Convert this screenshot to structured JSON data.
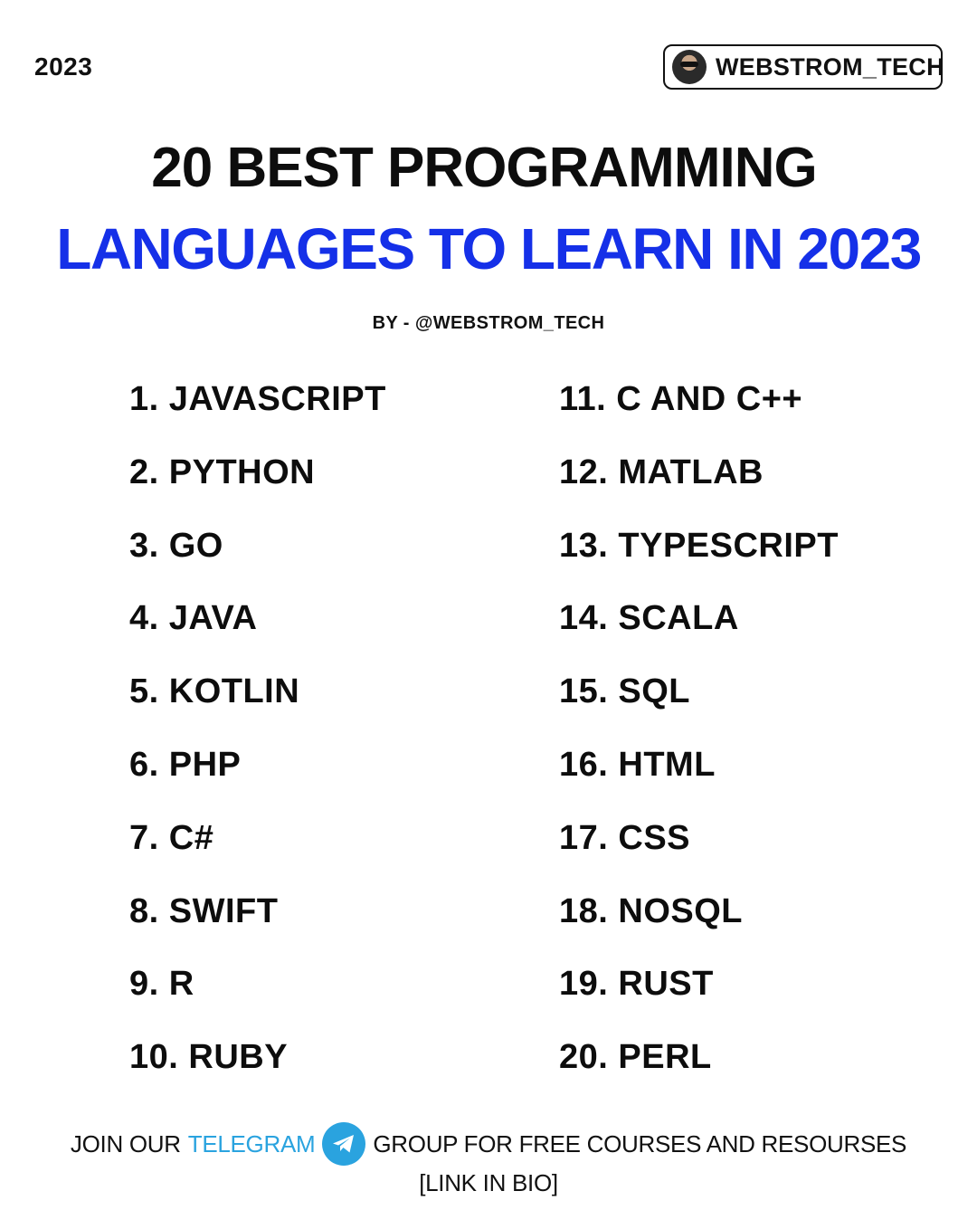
{
  "header": {
    "year": "2023",
    "handle": "WEBSTROM_TECH"
  },
  "title": {
    "line1": "20 BEST PROGRAMMING",
    "line2": "LANGUAGES TO LEARN IN 2023",
    "line2_color": "#1530e8"
  },
  "byline": "BY - @WEBSTROM_TECH",
  "languages": {
    "left": [
      "1. JAVASCRIPT",
      "2. PYTHON",
      "3. GO",
      "4. JAVA",
      "5. KOTLIN",
      "6. PHP",
      "7. C#",
      "8. SWIFT",
      "9. R",
      "10. RUBY"
    ],
    "right": [
      "11. C AND C++",
      "12. MATLAB",
      "13. TYPESCRIPT",
      "14. SCALA",
      "15. SQL",
      "16. HTML",
      "17. CSS",
      "18. NOSQL",
      "19. RUST",
      "20. PERL"
    ]
  },
  "footer": {
    "join_text": "JOIN OUR",
    "telegram_text": "TELEGRAM",
    "telegram_icon": "telegram-icon",
    "group_text": "GROUP FOR FREE COURSES AND RESOURSES",
    "link_text": "[LINK IN BIO]",
    "telegram_color": "#2aa3df"
  }
}
